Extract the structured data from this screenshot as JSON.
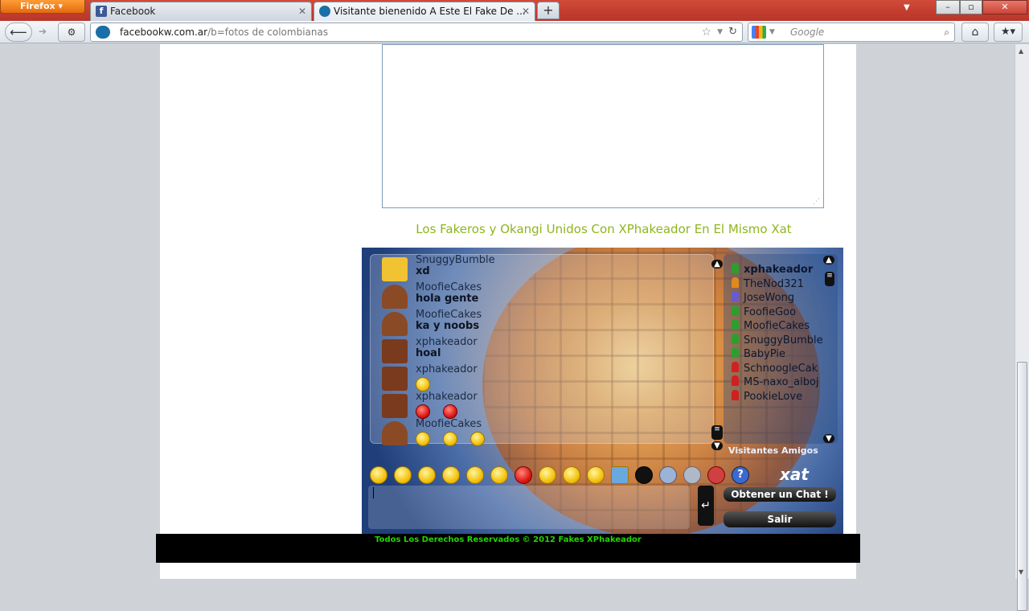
{
  "browser": {
    "menu_label": "Firefox",
    "tabs": [
      {
        "label": "Facebook"
      },
      {
        "label": "Visitante bienenido A Este El Fake De ..."
      }
    ],
    "new_tab": "+",
    "url_domain": "facebookw.com.ar",
    "url_path": "/b=fotos de colombianas",
    "search_placeholder": "Google",
    "window_controls": [
      "–",
      "▫",
      "✕"
    ]
  },
  "page": {
    "section_title": "Los Fakeros y Okangi Unidos Con XPhakeador En El Mismo Xat",
    "footer": "Todos Los Derechos Reservados © 2012 Fakes XPhakeador"
  },
  "chat": {
    "messages": [
      {
        "user": "SnuggyBumble",
        "text": "xd",
        "avatar_color": "#f1c232"
      },
      {
        "user": "MoofieCakes",
        "text": "hola gente",
        "avatar_color": "#8a4a26"
      },
      {
        "user": "MoofieCakes",
        "text": "ka y noobs",
        "avatar_color": "#8a4a26"
      },
      {
        "user": "xphakeador",
        "text": "hoal",
        "avatar_color": "#7a3a1e"
      },
      {
        "user": "xphakeador",
        "text": "",
        "avatar_color": "#7a3a1e"
      },
      {
        "user": "xphakeador",
        "text": "",
        "avatar_color": "#7a3a1e"
      },
      {
        "user": "MoofieCakes",
        "text": "",
        "avatar_color": "#8a4a26"
      }
    ],
    "users": [
      {
        "name": "xphakeador",
        "color": "#2e9d2e",
        "bold": true
      },
      {
        "name": "TheNod321",
        "color": "#e08a1e"
      },
      {
        "name": "JoseWong",
        "color": "#6a5ad0"
      },
      {
        "name": "FoofieGoo",
        "color": "#2e9d2e"
      },
      {
        "name": "MoofieCakes",
        "color": "#2e9d2e"
      },
      {
        "name": "SnuggyBumble",
        "color": "#2e9d2e"
      },
      {
        "name": "BabyPie",
        "color": "#2e9d2e"
      },
      {
        "name": "SchnoogleCak",
        "color": "#d02020"
      },
      {
        "name": "MS-naxo_alboj",
        "color": "#d02020"
      },
      {
        "name": "PookieLove",
        "color": "#d02020"
      }
    ],
    "tabs_label": "Visitantes Amigos",
    "get_chat_label": "Obtener un Chat !",
    "exit_label": "Salir",
    "logo": "xat"
  }
}
